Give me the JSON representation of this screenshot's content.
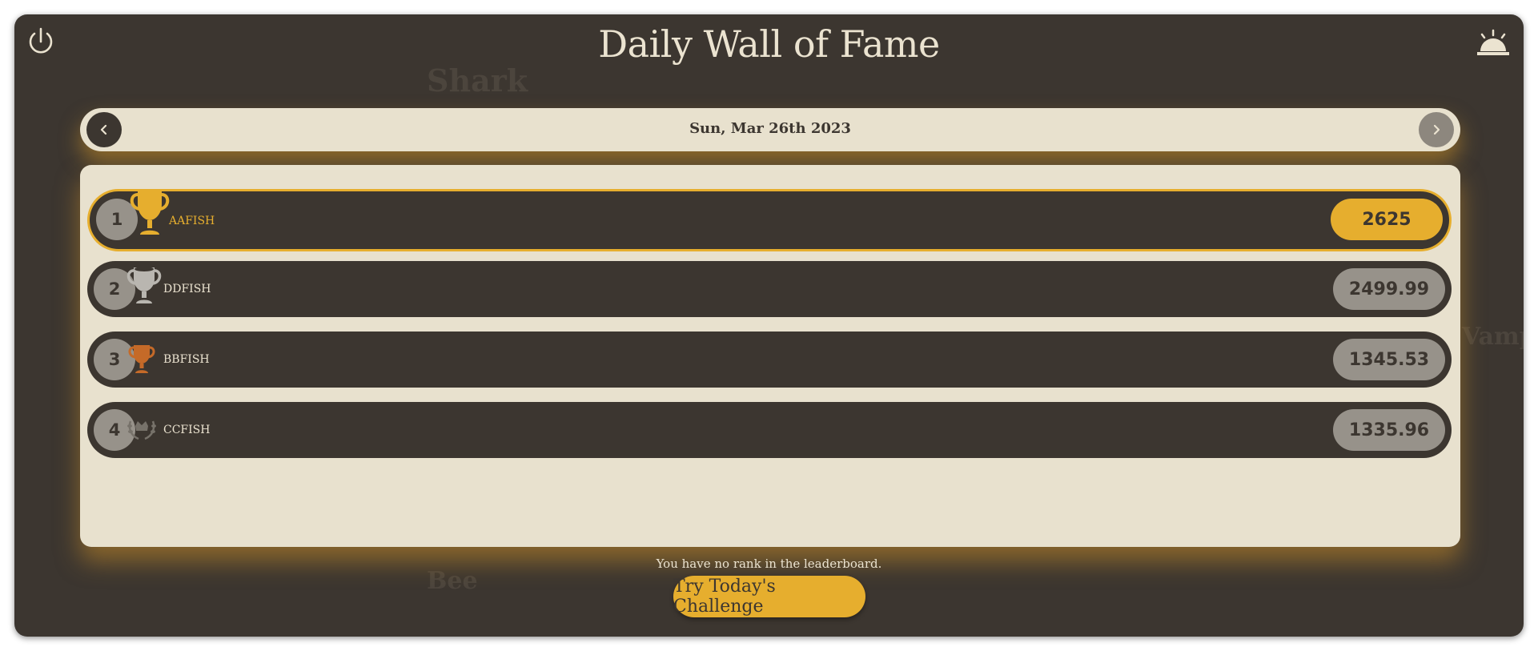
{
  "header": {
    "title": "Daily Wall of Fame"
  },
  "background_labels": [
    "Shark",
    "Vamp",
    "Bee"
  ],
  "date_nav": {
    "date": "Sun, Mar 26th 2023"
  },
  "leaderboard": [
    {
      "rank": "1",
      "name": "AAFISH",
      "score": "2625",
      "trophy": "gold-trophy-icon"
    },
    {
      "rank": "2",
      "name": "DDFISH",
      "score": "2499.99",
      "trophy": "silver-trophy-icon"
    },
    {
      "rank": "3",
      "name": "BBFISH",
      "score": "1345.53",
      "trophy": "bronze-trophy-icon"
    },
    {
      "rank": "4",
      "name": "CCFISH",
      "score": "1335.96",
      "trophy": "laurel-crown-icon"
    }
  ],
  "footer": {
    "no_rank_message": "You have no rank in the leaderboard.",
    "cta_label": "Try Today's Challenge"
  },
  "colors": {
    "background": "#3c3630",
    "panel": "#e8e1ce",
    "gold": "#e6ae2e",
    "silver": "#b9b6b0",
    "bronze": "#c56a28",
    "text_light": "#ebe3d0"
  }
}
